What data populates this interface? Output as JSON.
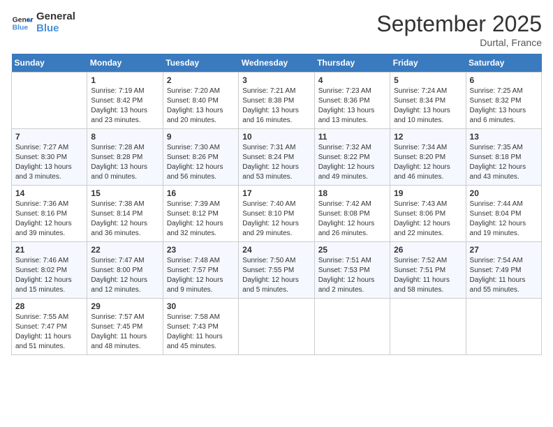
{
  "header": {
    "logo_line1": "General",
    "logo_line2": "Blue",
    "month_title": "September 2025",
    "location": "Durtal, France"
  },
  "days_of_week": [
    "Sunday",
    "Monday",
    "Tuesday",
    "Wednesday",
    "Thursday",
    "Friday",
    "Saturday"
  ],
  "weeks": [
    [
      {
        "day": "",
        "sunrise": "",
        "sunset": "",
        "daylight": ""
      },
      {
        "day": "1",
        "sunrise": "Sunrise: 7:19 AM",
        "sunset": "Sunset: 8:42 PM",
        "daylight": "Daylight: 13 hours and 23 minutes."
      },
      {
        "day": "2",
        "sunrise": "Sunrise: 7:20 AM",
        "sunset": "Sunset: 8:40 PM",
        "daylight": "Daylight: 13 hours and 20 minutes."
      },
      {
        "day": "3",
        "sunrise": "Sunrise: 7:21 AM",
        "sunset": "Sunset: 8:38 PM",
        "daylight": "Daylight: 13 hours and 16 minutes."
      },
      {
        "day": "4",
        "sunrise": "Sunrise: 7:23 AM",
        "sunset": "Sunset: 8:36 PM",
        "daylight": "Daylight: 13 hours and 13 minutes."
      },
      {
        "day": "5",
        "sunrise": "Sunrise: 7:24 AM",
        "sunset": "Sunset: 8:34 PM",
        "daylight": "Daylight: 13 hours and 10 minutes."
      },
      {
        "day": "6",
        "sunrise": "Sunrise: 7:25 AM",
        "sunset": "Sunset: 8:32 PM",
        "daylight": "Daylight: 13 hours and 6 minutes."
      }
    ],
    [
      {
        "day": "7",
        "sunrise": "Sunrise: 7:27 AM",
        "sunset": "Sunset: 8:30 PM",
        "daylight": "Daylight: 13 hours and 3 minutes."
      },
      {
        "day": "8",
        "sunrise": "Sunrise: 7:28 AM",
        "sunset": "Sunset: 8:28 PM",
        "daylight": "Daylight: 13 hours and 0 minutes."
      },
      {
        "day": "9",
        "sunrise": "Sunrise: 7:30 AM",
        "sunset": "Sunset: 8:26 PM",
        "daylight": "Daylight: 12 hours and 56 minutes."
      },
      {
        "day": "10",
        "sunrise": "Sunrise: 7:31 AM",
        "sunset": "Sunset: 8:24 PM",
        "daylight": "Daylight: 12 hours and 53 minutes."
      },
      {
        "day": "11",
        "sunrise": "Sunrise: 7:32 AM",
        "sunset": "Sunset: 8:22 PM",
        "daylight": "Daylight: 12 hours and 49 minutes."
      },
      {
        "day": "12",
        "sunrise": "Sunrise: 7:34 AM",
        "sunset": "Sunset: 8:20 PM",
        "daylight": "Daylight: 12 hours and 46 minutes."
      },
      {
        "day": "13",
        "sunrise": "Sunrise: 7:35 AM",
        "sunset": "Sunset: 8:18 PM",
        "daylight": "Daylight: 12 hours and 43 minutes."
      }
    ],
    [
      {
        "day": "14",
        "sunrise": "Sunrise: 7:36 AM",
        "sunset": "Sunset: 8:16 PM",
        "daylight": "Daylight: 12 hours and 39 minutes."
      },
      {
        "day": "15",
        "sunrise": "Sunrise: 7:38 AM",
        "sunset": "Sunset: 8:14 PM",
        "daylight": "Daylight: 12 hours and 36 minutes."
      },
      {
        "day": "16",
        "sunrise": "Sunrise: 7:39 AM",
        "sunset": "Sunset: 8:12 PM",
        "daylight": "Daylight: 12 hours and 32 minutes."
      },
      {
        "day": "17",
        "sunrise": "Sunrise: 7:40 AM",
        "sunset": "Sunset: 8:10 PM",
        "daylight": "Daylight: 12 hours and 29 minutes."
      },
      {
        "day": "18",
        "sunrise": "Sunrise: 7:42 AM",
        "sunset": "Sunset: 8:08 PM",
        "daylight": "Daylight: 12 hours and 26 minutes."
      },
      {
        "day": "19",
        "sunrise": "Sunrise: 7:43 AM",
        "sunset": "Sunset: 8:06 PM",
        "daylight": "Daylight: 12 hours and 22 minutes."
      },
      {
        "day": "20",
        "sunrise": "Sunrise: 7:44 AM",
        "sunset": "Sunset: 8:04 PM",
        "daylight": "Daylight: 12 hours and 19 minutes."
      }
    ],
    [
      {
        "day": "21",
        "sunrise": "Sunrise: 7:46 AM",
        "sunset": "Sunset: 8:02 PM",
        "daylight": "Daylight: 12 hours and 15 minutes."
      },
      {
        "day": "22",
        "sunrise": "Sunrise: 7:47 AM",
        "sunset": "Sunset: 8:00 PM",
        "daylight": "Daylight: 12 hours and 12 minutes."
      },
      {
        "day": "23",
        "sunrise": "Sunrise: 7:48 AM",
        "sunset": "Sunset: 7:57 PM",
        "daylight": "Daylight: 12 hours and 9 minutes."
      },
      {
        "day": "24",
        "sunrise": "Sunrise: 7:50 AM",
        "sunset": "Sunset: 7:55 PM",
        "daylight": "Daylight: 12 hours and 5 minutes."
      },
      {
        "day": "25",
        "sunrise": "Sunrise: 7:51 AM",
        "sunset": "Sunset: 7:53 PM",
        "daylight": "Daylight: 12 hours and 2 minutes."
      },
      {
        "day": "26",
        "sunrise": "Sunrise: 7:52 AM",
        "sunset": "Sunset: 7:51 PM",
        "daylight": "Daylight: 11 hours and 58 minutes."
      },
      {
        "day": "27",
        "sunrise": "Sunrise: 7:54 AM",
        "sunset": "Sunset: 7:49 PM",
        "daylight": "Daylight: 11 hours and 55 minutes."
      }
    ],
    [
      {
        "day": "28",
        "sunrise": "Sunrise: 7:55 AM",
        "sunset": "Sunset: 7:47 PM",
        "daylight": "Daylight: 11 hours and 51 minutes."
      },
      {
        "day": "29",
        "sunrise": "Sunrise: 7:57 AM",
        "sunset": "Sunset: 7:45 PM",
        "daylight": "Daylight: 11 hours and 48 minutes."
      },
      {
        "day": "30",
        "sunrise": "Sunrise: 7:58 AM",
        "sunset": "Sunset: 7:43 PM",
        "daylight": "Daylight: 11 hours and 45 minutes."
      },
      {
        "day": "",
        "sunrise": "",
        "sunset": "",
        "daylight": ""
      },
      {
        "day": "",
        "sunrise": "",
        "sunset": "",
        "daylight": ""
      },
      {
        "day": "",
        "sunrise": "",
        "sunset": "",
        "daylight": ""
      },
      {
        "day": "",
        "sunrise": "",
        "sunset": "",
        "daylight": ""
      }
    ]
  ]
}
